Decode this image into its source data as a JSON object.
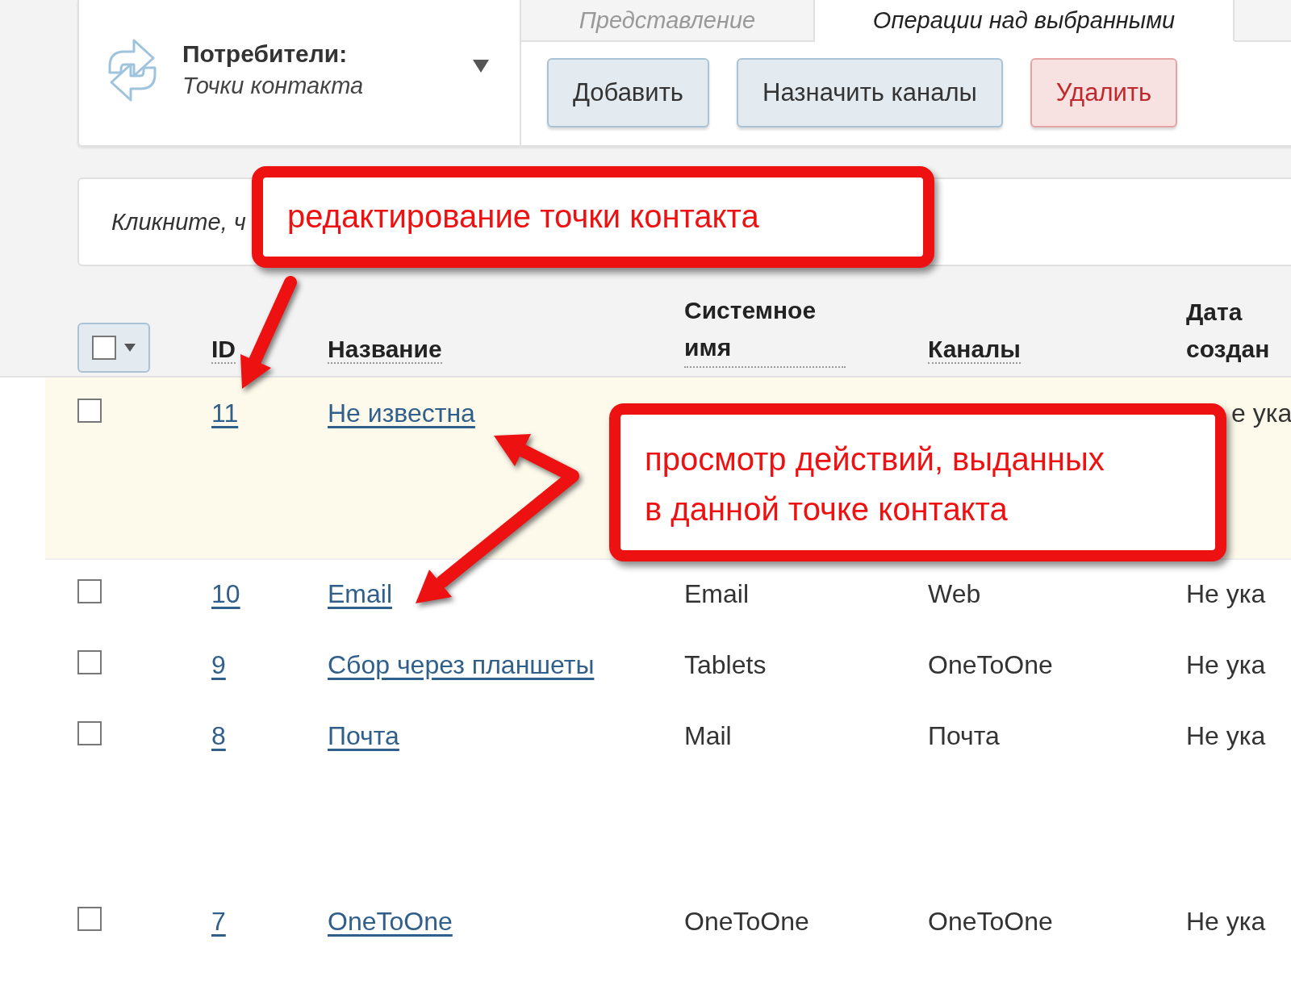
{
  "header": {
    "title": "Потребители:",
    "subtitle": "Точки контакта"
  },
  "tabs": [
    {
      "label": "Представление",
      "selected": false
    },
    {
      "label": "Операции над выбранными",
      "selected": true
    }
  ],
  "buttons": [
    {
      "label": "Добавить",
      "kind": "normal"
    },
    {
      "label": "Назначить каналы",
      "kind": "normal"
    },
    {
      "label": "Удалить",
      "kind": "danger"
    }
  ],
  "hint": "Кликните, ч",
  "table": {
    "select_all": {
      "checked": false
    },
    "columns": [
      {
        "label": "ID"
      },
      {
        "label": "Название"
      },
      {
        "label": "Системное имя"
      },
      {
        "label": "Каналы"
      },
      {
        "label": "Дата создан"
      }
    ],
    "rows": [
      {
        "id": "11",
        "name": "Не известна",
        "system_name": "",
        "channels": "",
        "date": "е ука",
        "checked": false,
        "highlighted": true
      },
      {
        "id": "10",
        "name": "Email",
        "system_name": "Email",
        "channels": "Web",
        "date": "Не ука",
        "checked": false,
        "highlighted": false
      },
      {
        "id": "9",
        "name": "Сбор через планшеты",
        "system_name": "Tablets",
        "channels": "OneToOne",
        "date": "Не ука",
        "checked": false,
        "highlighted": false
      },
      {
        "id": "8",
        "name": "Почта",
        "system_name": "Mail",
        "channels": "Почта",
        "date": "Не ука",
        "checked": false,
        "highlighted": false
      },
      {
        "id": "7",
        "name": "OneToOne",
        "system_name": "OneToOne",
        "channels": "OneToOne",
        "date": "Не ука",
        "checked": false,
        "highlighted": false
      }
    ]
  },
  "callouts": [
    {
      "text": "редактирование точки контакта"
    },
    {
      "text": "просмотр действий, выданных в данной точке контакта"
    }
  ]
}
